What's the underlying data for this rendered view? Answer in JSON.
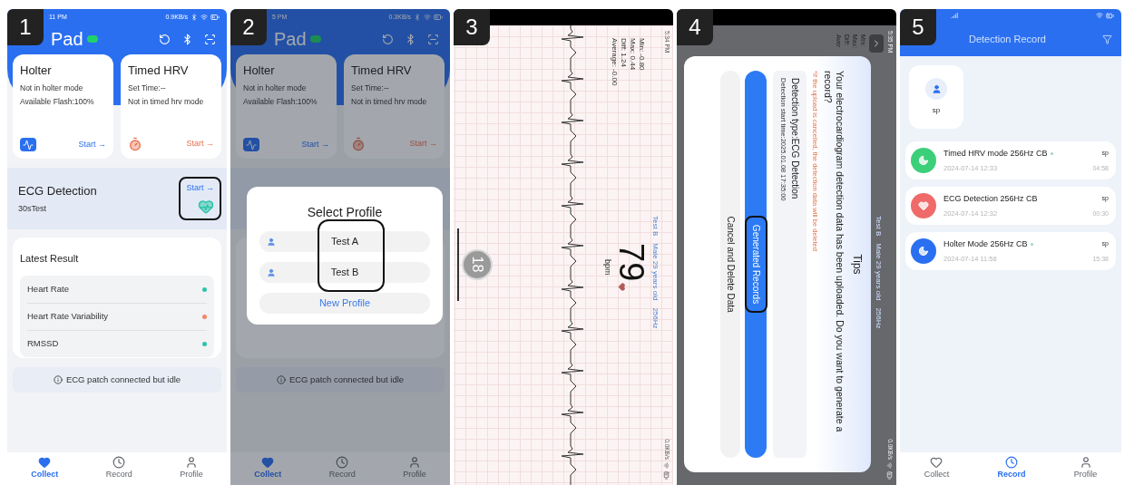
{
  "panels": [
    {
      "kind": "home",
      "badge": "1",
      "dimmed": false,
      "status": {
        "time": "11 PM",
        "speed": "0.9KB/s"
      },
      "title": "Pad",
      "cards": [
        {
          "kind": "holter",
          "title": "Holter",
          "lines": [
            "Not in holter mode",
            "Available Flash:100%"
          ],
          "action": "Start →"
        },
        {
          "kind": "timer",
          "title": "Timed HRV",
          "lines": [
            "Set Time:--",
            "Not in timed hrv mode"
          ],
          "action": "Start →"
        }
      ],
      "ecg": {
        "title": "ECG Detection",
        "subtitle": "30sTest",
        "action": "Start →",
        "highlighted": true
      },
      "latest": {
        "title": "Latest Result",
        "items": [
          {
            "label": "Heart Rate",
            "color": "#2ec4a8"
          },
          {
            "label": "Heart Rate Variability",
            "color": "#f0866a"
          },
          {
            "label": "RMSSD",
            "color": "#2ec4a8"
          }
        ]
      },
      "notice": "ECG patch connected but idle",
      "nav": [
        {
          "kind": "collect",
          "label": "Collect",
          "selected": true
        },
        {
          "kind": "record",
          "label": "Record",
          "selected": false
        },
        {
          "kind": "profile",
          "label": "Profile",
          "selected": false
        }
      ]
    },
    {
      "kind": "home",
      "badge": "2",
      "dimmed": true,
      "status": {
        "time": "5 PM",
        "speed": "0.3KB/s"
      },
      "title": "Pad",
      "cards": [
        {
          "kind": "holter",
          "title": "Holter",
          "lines": [
            "Not in holter mode",
            "Available Flash:100%"
          ],
          "action": "Start →"
        },
        {
          "kind": "timer",
          "title": "Timed HRV",
          "lines": [
            "Set Time:--",
            "Not in timed hrv mode"
          ],
          "action": "Start →"
        }
      ],
      "dialog": {
        "title": "Select Profile",
        "profiles": [
          {
            "name": "Test A"
          },
          {
            "name": "Test B"
          }
        ],
        "highlighted": true,
        "action": "New Profile"
      },
      "notice": "ECG patch connected but idle",
      "nav": [
        {
          "kind": "collect",
          "label": "Collect",
          "selected": true
        },
        {
          "kind": "record",
          "label": "Record",
          "selected": false
        },
        {
          "kind": "profile",
          "label": "Profile",
          "selected": false
        }
      ]
    },
    {
      "kind": "ecg_live",
      "badge": "3",
      "status": {
        "time": "5:34 PM",
        "speed": "0.0KB/s"
      },
      "stats": [
        "Min: -0.80",
        "Max: 0.44",
        "Diff: 1.24",
        "Average: -0.00"
      ],
      "subject": [
        "Test B",
        "Male 29 years old",
        "256Hz"
      ],
      "heart_rate": "79",
      "unit": "bpm",
      "counter": "18"
    },
    {
      "kind": "ecg_dialog",
      "badge": "4",
      "status": {
        "time": "5:35 PM",
        "speed": "0.0KB/s"
      },
      "stats": [
        "Min:",
        "Max:",
        "Diff:",
        "Aver"
      ],
      "subject": [
        "Test B",
        "Male 29 years old",
        "256Hz"
      ],
      "dialog": {
        "title": "Tips",
        "message": "Your electrocardiogram detection data has been uploaded. Do you want to generate a record?",
        "warning": "*If the upload is cancelled, the detection data will be deleted",
        "details": [
          "Detection type:ECG Detection",
          "Detection start time:2025.01.08 17:35:00"
        ],
        "confirm": {
          "label": "Generated Records",
          "highlighted": true
        },
        "cancel": "Cancel and Delete Data"
      }
    },
    {
      "kind": "records",
      "badge": "5",
      "title": "Detection Record",
      "profiles": [
        {
          "name": "sp"
        }
      ],
      "records": [
        {
          "kind": "hrv",
          "color": "#3ccf7a",
          "title": "Timed HRV mode 256Hz CB",
          "marked": true,
          "user": "sp",
          "date": "2024-07-14 12:33",
          "duration": "04:58"
        },
        {
          "kind": "ecg",
          "color": "#f06a6a",
          "title": "ECG Detection 256Hz CB",
          "marked": false,
          "user": "sp",
          "date": "2024-07-14 12:32",
          "duration": "00:30"
        },
        {
          "kind": "holter",
          "color": "#2a6ff0",
          "title": "Holter Mode 256Hz CB",
          "marked": true,
          "user": "sp",
          "date": "2024-07-14 11:58",
          "duration": "15:38"
        }
      ],
      "nav": [
        {
          "kind": "collect",
          "label": "Collect",
          "selected": false
        },
        {
          "kind": "record",
          "label": "Record",
          "selected": true
        },
        {
          "kind": "profile",
          "label": "Profile",
          "selected": false
        }
      ]
    }
  ]
}
